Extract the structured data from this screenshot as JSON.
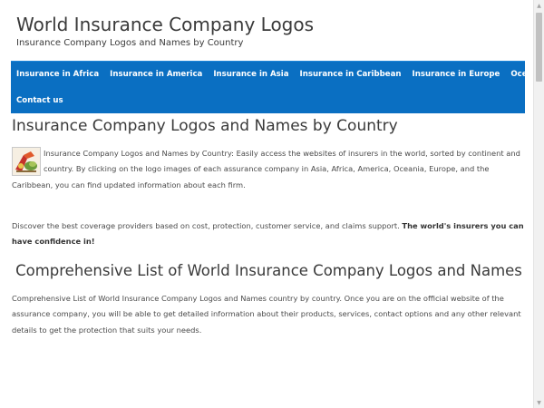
{
  "header": {
    "title": "World Insurance Company Logos",
    "tagline": "Insurance Company Logos and Names by Country"
  },
  "nav": {
    "items": [
      {
        "label": "Insurance in Africa"
      },
      {
        "label": "Insurance in America"
      },
      {
        "label": "Insurance in Asia"
      },
      {
        "label": "Insurance in Caribbean"
      },
      {
        "label": "Insurance in Europe"
      },
      {
        "label": "Oceania Insurance"
      },
      {
        "label": "Contact us"
      }
    ]
  },
  "main": {
    "heading": "Insurance Company Logos and Names by Country",
    "intro": "Insurance Company Logos and Names by Country: Easily access the websites of insurers in the world, sorted by continent and country. By clicking on the logo images of each assurance company in Asia, Africa, America, Oceania, Europe, and the Caribbean, you can find updated information about each firm.",
    "discover_text": "Discover the best coverage providers based on cost, protection, customer service, and claims support. ",
    "discover_bold": "The world's insurers you can have confidence in!",
    "subheading": "Comprehensive List of World Insurance Company Logos and Names",
    "list_text": "Comprehensive List of World Insurance Company Logos and Names country by country. Once you are on the official website of the assurance company, you will be able to get detailed information about their products, services, contact options and any other relevant details to get the protection that suits your needs."
  },
  "colors": {
    "nav_bg": "#0a6fc2",
    "text": "#3a3a3a"
  }
}
